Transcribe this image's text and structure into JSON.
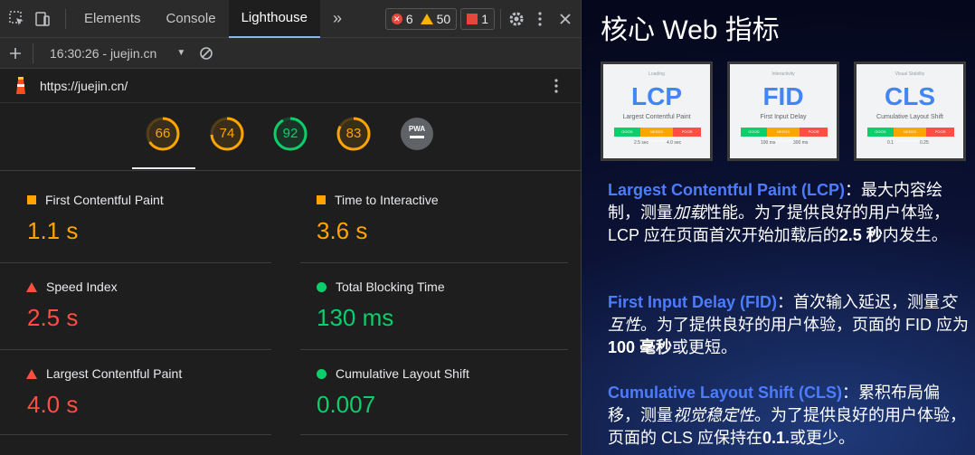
{
  "devtools": {
    "tabs": [
      "Elements",
      "Console",
      "Lighthouse"
    ],
    "more": "»",
    "errors": "6",
    "warnings": "50",
    "issues": "1",
    "report_label": "16:30:26 - juejin.cn",
    "url": "https://juejin.cn/",
    "gauges": [
      {
        "value": "66",
        "color": "#ffa400",
        "score": 0.66
      },
      {
        "value": "74",
        "color": "#ffa400",
        "score": 0.74
      },
      {
        "value": "92",
        "color": "#0cce6b",
        "score": 0.92
      },
      {
        "value": "83",
        "color": "#ffa400",
        "score": 0.83
      },
      {
        "value": "PWA",
        "color": "#9aa0a6",
        "score": 0
      }
    ],
    "metrics": [
      {
        "label": "First Contentful Paint",
        "value": "1.1 s",
        "indicator": "square",
        "color": "#ffa400"
      },
      {
        "label": "Time to Interactive",
        "value": "3.6 s",
        "indicator": "square",
        "color": "#ffa400"
      },
      {
        "label": "Speed Index",
        "value": "2.5 s",
        "indicator": "triangle",
        "color": "#ff4e42"
      },
      {
        "label": "Total Blocking Time",
        "value": "130 ms",
        "indicator": "circle",
        "color": "#0cce6b"
      },
      {
        "label": "Largest Contentful Paint",
        "value": "4.0 s",
        "indicator": "triangle",
        "color": "#ff4e42"
      },
      {
        "label": "Cumulative Layout Shift",
        "value": "0.007",
        "indicator": "circle",
        "color": "#0cce6b"
      }
    ]
  },
  "slide": {
    "title": "核心 Web 指标",
    "thumbs": [
      {
        "name": "LCP",
        "sub": "Largest Contentful Paint",
        "tag": "Loading",
        "ticks": [
          "2.5 sec",
          "4.0 sec"
        ]
      },
      {
        "name": "FID",
        "sub": "First Input Delay",
        "tag": "Interactivity",
        "ticks": [
          "100 ms",
          "300 ms"
        ]
      },
      {
        "name": "CLS",
        "sub": "Cumulative Layout Shift",
        "tag": "Visual Stability",
        "ticks": [
          "0.1",
          "0.25"
        ]
      }
    ],
    "bar_labels": [
      "GOOD",
      "NEEDS IMPROVEMENT",
      "POOR"
    ],
    "p1": {
      "term": "Largest Contentful Paint (LCP)",
      "t1": "：最大内容绘制，测量",
      "em": "加载",
      "t2": "性能。为了提供良好的用户体验，LCP 应在页面首次开始加载后的",
      "bold": "2.5 秒",
      "t3": "内发生。"
    },
    "p2": {
      "term": "First Input Delay (FID)",
      "t1": "：首次输入延迟，测量",
      "em": "交互性",
      "t2": "。为了提供良好的用户体验，页面的 FID 应为",
      "bold": "100 毫秒",
      "t3": "或更短。"
    },
    "p3": {
      "term": "Cumulative Layout Shift (CLS)",
      "t1": "：累积布局偏移，测量",
      "em": "视觉稳定性",
      "t2": "。为了提供良好的用户体验，页面的 CLS 应保持在",
      "bold": "0.1.",
      "t3": "或更少。"
    }
  }
}
